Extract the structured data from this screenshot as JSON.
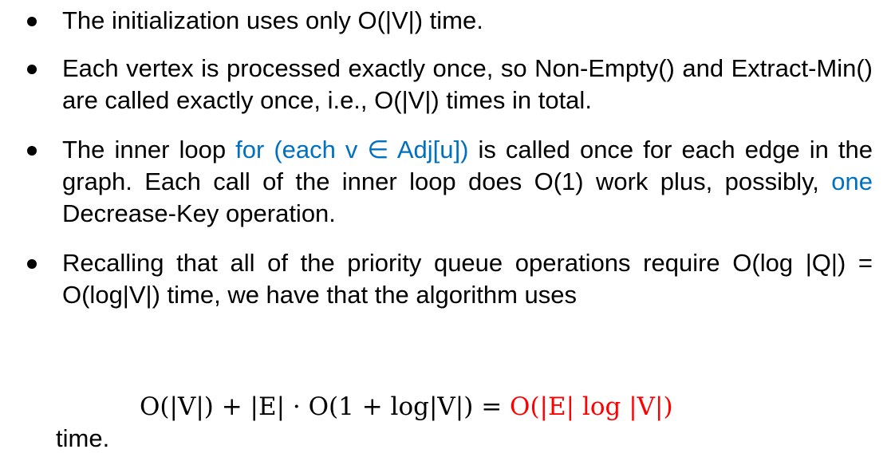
{
  "bullets": [
    {
      "text": "The initialization uses only O(|V|) time."
    },
    {
      "text": "Each vertex is processed exactly once, so Non-Empty() and Extract-Min() are called exactly once, i.e., O(|V|) times in total."
    },
    {
      "pre": "The inner loop ",
      "highlight_loop": "for (each v ∈ Adj[u])",
      "mid": " is called once for each edge in the graph. Each call of the inner loop does O(1) work plus, possibly, ",
      "highlight_one": "one",
      "post": " Decrease-Key operation."
    },
    {
      "text": "Recalling that all of the priority queue operations require O(log |Q|) = O(log|V|) time, we have that the algorithm uses",
      "formula_black": "O(|V|) + |E| · O(1 + log|V|) = ",
      "formula_red": "O(|E| log |V|)"
    }
  ],
  "tail": "time.",
  "colors": {
    "text": "#000000",
    "highlight_blue": "#0070c0",
    "highlight_red": "#ff0000"
  }
}
